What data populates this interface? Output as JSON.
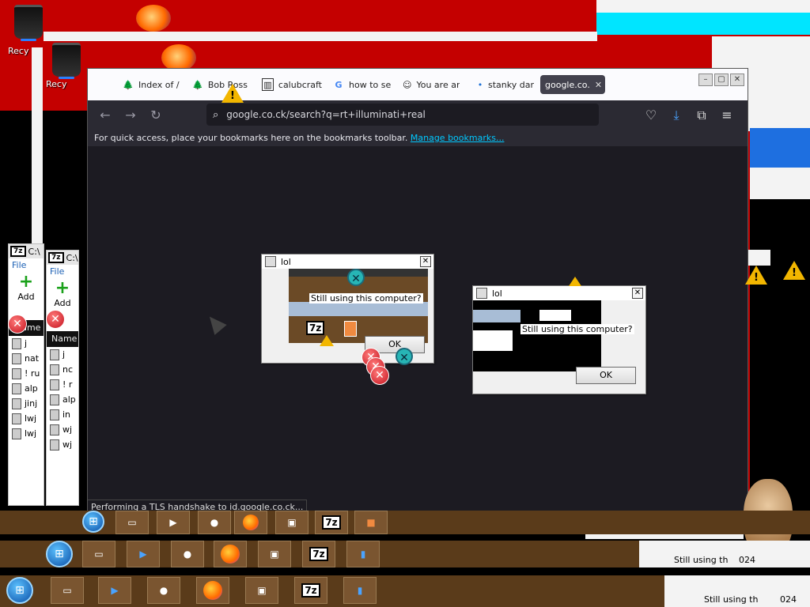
{
  "desktop": {
    "recycle_bin_label": "Recy",
    "recycle_bin_label_2": "Recy"
  },
  "side_windows": [
    {
      "title": "C:\\",
      "menu_file": "File",
      "add_label": "Add",
      "column": "Name",
      "rows": [
        "j",
        "nat",
        "! ru",
        "alp",
        "jinj",
        "lwj",
        "lwj"
      ]
    },
    {
      "title": "C:\\",
      "menu_file": "File",
      "add_label": "Add",
      "column": "Name",
      "rows": [
        "j",
        "nc",
        "! r",
        "alp",
        "in",
        "wj",
        "wj"
      ]
    }
  ],
  "browser": {
    "tabs": [
      {
        "label": "Index of /",
        "icon": "tree-icon"
      },
      {
        "label": "Bob Ross",
        "icon": "tree-icon"
      },
      {
        "label": "calubcraft",
        "icon": "box-icon"
      },
      {
        "label": "how to se",
        "icon": "google-icon"
      },
      {
        "label": "You are an",
        "icon": "smiley-icon"
      },
      {
        "label": "stanky dar",
        "icon": "dot-icon"
      },
      {
        "label": "google.co.",
        "icon": "none",
        "active": true
      }
    ],
    "url": "google.co.ck/search?q=rt+illuminati+real",
    "bookmark_hint": "For quick access, place your bookmarks here on the bookmarks toolbar.",
    "bookmark_link": "Manage bookmarks...",
    "status": "Performing a TLS handshake to id.google.co.ck..."
  },
  "dialogs": [
    {
      "title": "lol",
      "message": "Still using this computer?",
      "ok": "OK"
    },
    {
      "title": "lol",
      "message": "Still using this computer?",
      "ok": "OK"
    }
  ],
  "taskbar": {
    "clock_1": "024",
    "clock_2": "024",
    "ghost_text_1": "Still using th",
    "ghost_text_2": "Still using th"
  },
  "colors": {
    "desktop_red": "#c40000",
    "browser_dark": "#1c1b22",
    "link_cyan": "#00c8ff",
    "taskbar_brown": "#5a3b1a"
  }
}
